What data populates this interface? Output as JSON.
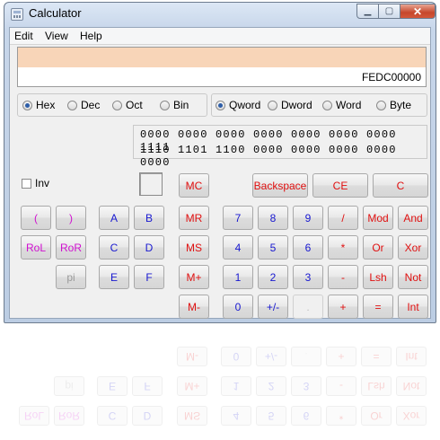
{
  "window": {
    "title": "Calculator"
  },
  "menu": {
    "items": [
      "Edit",
      "View",
      "Help"
    ]
  },
  "display": {
    "value": "FEDC00000"
  },
  "radix": {
    "options": [
      "Hex",
      "Dec",
      "Oct",
      "Bin"
    ],
    "selected": "Hex"
  },
  "word_size": {
    "options": [
      "Qword",
      "Dword",
      "Word",
      "Byte"
    ],
    "selected": "Qword"
  },
  "bits": {
    "row1": "0000 0000 0000 0000 0000 0000 0000 1111",
    "row2": "1110 1101 1100 0000 0000 0000 0000 0000"
  },
  "inv": {
    "label": "Inv"
  },
  "buttons": {
    "backspace": "Backspace",
    "ce": "CE",
    "c": "C",
    "mc": "MC",
    "mr": "MR",
    "ms": "MS",
    "mplus": "M+",
    "mminus": "M-",
    "lparen": "(",
    "rparen": ")",
    "rol": "RoL",
    "ror": "RoR",
    "pi": "pi",
    "a": "A",
    "b": "B",
    "cc": "C",
    "d": "D",
    "e": "E",
    "f": "F",
    "n7": "7",
    "n8": "8",
    "n9": "9",
    "n4": "4",
    "n5": "5",
    "n6": "6",
    "n1": "1",
    "n2": "2",
    "n3": "3",
    "n0": "0",
    "sign": "+/-",
    "dot": ".",
    "div": "/",
    "mul": "*",
    "sub": "-",
    "add": "+",
    "eq": "=",
    "mod": "Mod",
    "and": "And",
    "or": "Or",
    "xor": "Xor",
    "lsh": "Lsh",
    "not": "Not",
    "int": "Int"
  },
  "colors": {
    "red": "#e01010",
    "blue": "#1818d0",
    "magenta": "#d010d0",
    "display_band": "#f8d5b8"
  },
  "icons": {
    "app": "calculator-icon",
    "minimize": "minimize-icon",
    "maximize": "maximize-icon",
    "close": "close-icon"
  }
}
